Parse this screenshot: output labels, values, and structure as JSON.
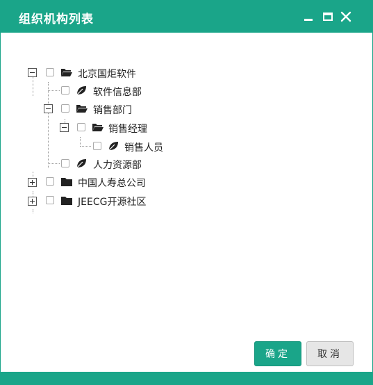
{
  "dialog": {
    "title": "组织机构列表"
  },
  "tree": {
    "nodes": [
      {
        "label": "北京国炬软件"
      },
      {
        "label": "软件信息部"
      },
      {
        "label": "销售部门"
      },
      {
        "label": "销售经理"
      },
      {
        "label": "销售人员"
      },
      {
        "label": "人力资源部"
      },
      {
        "label": "中国人寿总公司"
      },
      {
        "label": "JEECG开源社区"
      }
    ]
  },
  "buttons": {
    "ok": "确定",
    "cancel": "取消"
  },
  "colors": {
    "accent": "#1aa589"
  }
}
